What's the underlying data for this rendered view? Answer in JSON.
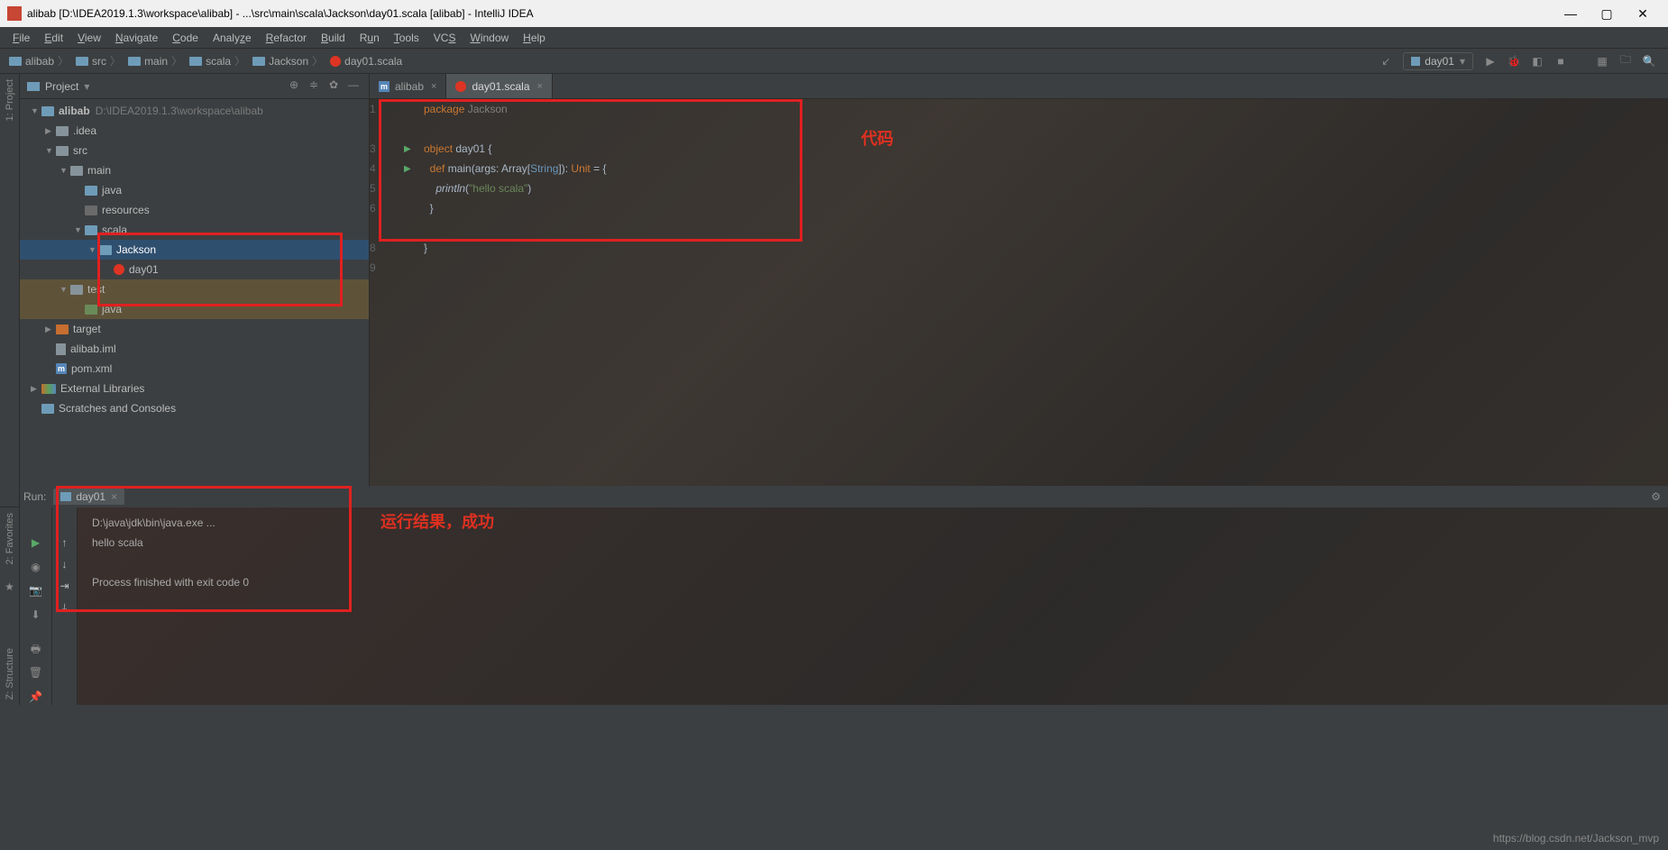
{
  "window": {
    "title": "alibab [D:\\IDEA2019.1.3\\workspace\\alibab] - ...\\src\\main\\scala\\Jackson\\day01.scala [alibab] - IntelliJ IDEA"
  },
  "menu": [
    "File",
    "Edit",
    "View",
    "Navigate",
    "Code",
    "Analyze",
    "Refactor",
    "Build",
    "Run",
    "Tools",
    "VCS",
    "Window",
    "Help"
  ],
  "breadcrumbs": [
    "alibab",
    "src",
    "main",
    "scala",
    "Jackson",
    "day01.scala"
  ],
  "run_config": "day01",
  "project_panel": {
    "title": "Project"
  },
  "tree": {
    "root": {
      "name": "alibab",
      "path": "D:\\IDEA2019.1.3\\workspace\\alibab"
    },
    "idea": ".idea",
    "src": "src",
    "main": "main",
    "java": "java",
    "resources": "resources",
    "scala": "scala",
    "jackson": "Jackson",
    "day01": "day01",
    "test": "test",
    "test_java": "java",
    "target": "target",
    "iml": "alibab.iml",
    "pom": "pom.xml",
    "ext": "External Libraries",
    "scratch": "Scratches and Consoles"
  },
  "tabs": [
    {
      "label": "alibab",
      "icon": "m"
    },
    {
      "label": "day01.scala",
      "icon": "scala",
      "active": true
    }
  ],
  "code": {
    "l1_pkg": "package",
    "l1_name": " Jackson",
    "l3_obj": "object",
    "l3_name": " day01 {",
    "l4_def": "def",
    "l4_sig1": " main(args: Array[",
    "l4_str": "String",
    "l4_sig2": "]): ",
    "l4_unit": "Unit",
    "l4_sig3": " = {",
    "l5_call": "println",
    "l5_arg": "(\"hello scala\")",
    "l5_str": "\"hello scala\"",
    "l6": "}",
    "l8": "}"
  },
  "annotations": {
    "code_label": "代码",
    "result_label": "运行结果，成功"
  },
  "run": {
    "label": "Run:",
    "tab": "day01",
    "out1": "D:\\java\\jdk\\bin\\java.exe ...",
    "out2": "hello scala",
    "out3": "Process finished with exit code 0"
  },
  "sidebar_left": {
    "project": "1: Project",
    "favorites": "2: Favorites",
    "structure": "Z: Structure"
  },
  "footer": "https://blog.csdn.net/Jackson_mvp"
}
